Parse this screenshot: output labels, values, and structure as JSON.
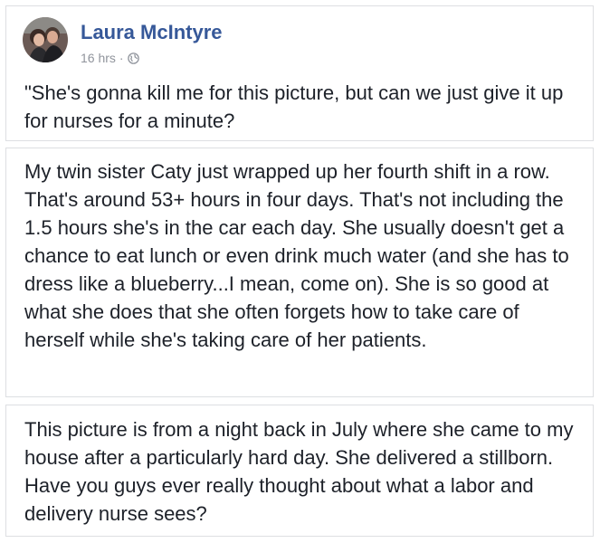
{
  "post": {
    "author_name": "Laura McIntyre",
    "timestamp": "16 hrs",
    "separator": "·",
    "privacy_icon": "globe-icon",
    "intro_text": "\"She's gonna kill me for this picture, but can we just give it up for nurses for a minute?"
  },
  "excerpts": [
    {
      "text": "My twin sister Caty just wrapped up her fourth shift in a row. That's around 53+ hours in four days. That's not including the 1.5 hours she's in the car each day. She usually doesn't get a chance to eat lunch or even drink much water (and she has to dress like a blueberry...I mean, come on). She is so good at what she does that she often forgets how to take care of herself while she's taking care of her patients."
    },
    {
      "text": "This picture is from a night back in July where she came to my house after a particularly hard day. She delivered a stillborn. Have you guys ever really thought about what a labor and delivery nurse sees?"
    }
  ],
  "colors": {
    "author_link": "#365899",
    "meta_text": "#90949c",
    "body_text": "#1d2129",
    "card_border": "#dddfe2"
  }
}
